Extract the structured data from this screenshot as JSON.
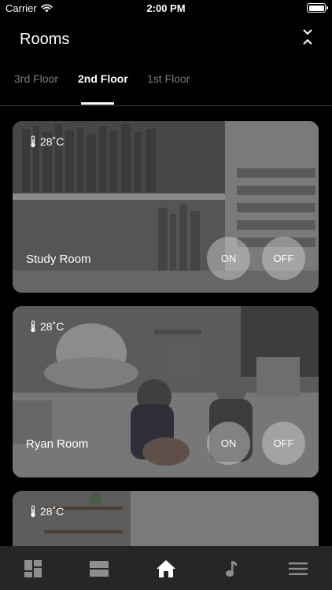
{
  "status_bar": {
    "carrier": "Carrier",
    "time": "2:00 PM"
  },
  "header": {
    "title": "Rooms",
    "collapse_icon": "collapse-arrows-icon"
  },
  "floor_tabs": [
    {
      "label": "3rd Floor",
      "active": false
    },
    {
      "label": "2nd Floor",
      "active": true
    },
    {
      "label": "1st Floor",
      "active": false
    }
  ],
  "rooms": [
    {
      "name": "Study Room",
      "temperature": "28˚C",
      "on_label": "ON",
      "off_label": "OFF"
    },
    {
      "name": "Ryan Room",
      "temperature": "28˚C",
      "on_label": "ON",
      "off_label": "OFF"
    },
    {
      "name": "",
      "temperature": "28˚C"
    }
  ],
  "bottom_tabs": [
    "dashboard-icon",
    "panels-icon",
    "home-icon",
    "music-icon",
    "menu-icon"
  ],
  "colors": {
    "background": "#000000",
    "tab_inactive": "#7d7d82",
    "tab_bar": "#262626",
    "toggle_bg": "rgba(215,215,215,0.45)"
  }
}
